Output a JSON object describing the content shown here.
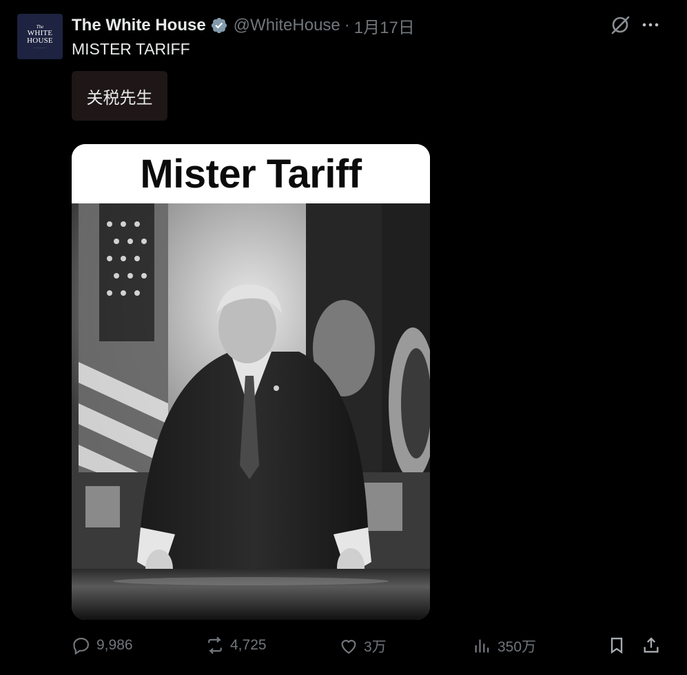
{
  "account": {
    "name": "The White House",
    "handle": "@WhiteHouse",
    "separator": "·",
    "date": "1月17日",
    "avatar_text": {
      "the": "The",
      "line1": "WHITE",
      "line2": "HOUSE"
    }
  },
  "tweet": {
    "text": "MISTER TARIFF",
    "translation": "关税先生"
  },
  "media": {
    "title": "Mister Tariff"
  },
  "actions": {
    "replies": "9,986",
    "reposts": "4,725",
    "likes": "3万",
    "views": "350万"
  },
  "colors": {
    "background": "#000000",
    "text": "#e7e9ea",
    "muted": "#71767b",
    "verified_badge": "#829aab"
  },
  "icons": [
    "verified-badge-icon",
    "grok-icon",
    "more-icon",
    "reply-icon",
    "repost-icon",
    "like-icon",
    "views-icon",
    "bookmark-icon",
    "share-icon"
  ]
}
